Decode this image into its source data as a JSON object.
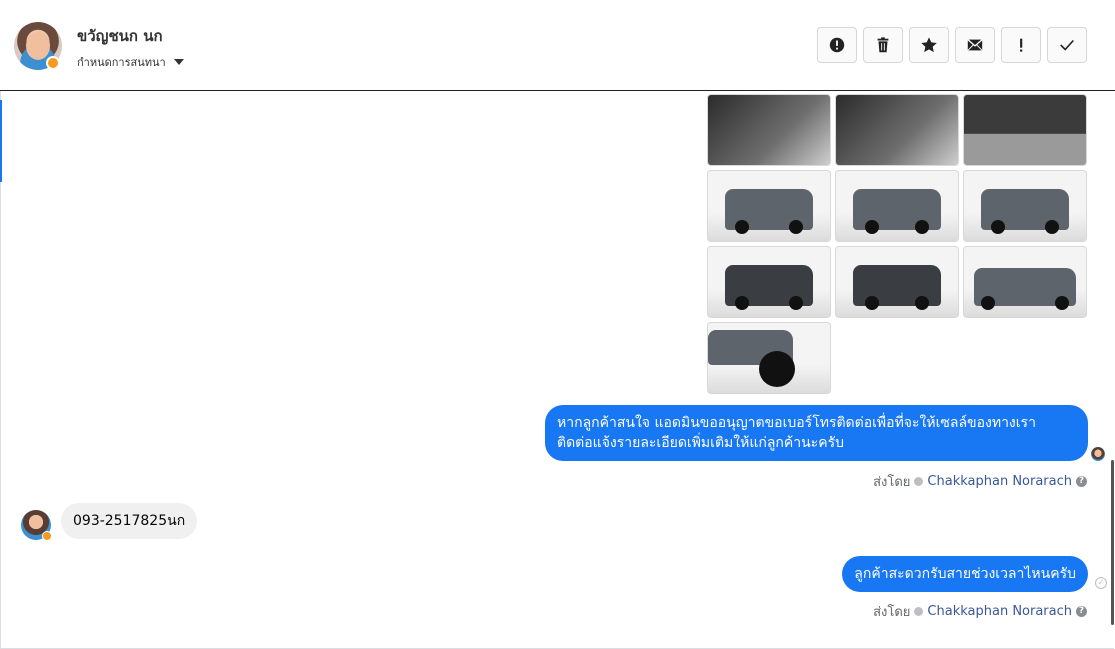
{
  "header": {
    "contact_name": "ขวัญชนก นก",
    "assign_label": "กำหนดการสนทนา",
    "actions": [
      {
        "icon": "alert-circle-icon",
        "name": "mark-spam-button"
      },
      {
        "icon": "trash-icon",
        "name": "delete-button"
      },
      {
        "icon": "star-icon",
        "name": "star-button"
      },
      {
        "icon": "envelope-icon",
        "name": "mark-unread-button"
      },
      {
        "icon": "exclamation-icon",
        "name": "follow-up-button"
      },
      {
        "icon": "check-icon",
        "name": "mark-done-button"
      }
    ],
    "status_color": "#f59a1d"
  },
  "images": [
    "interior-rear-seats",
    "interior-dashboard",
    "engine-bay",
    "front-left-view",
    "front-view",
    "front-right-view",
    "rear-left-view",
    "rear-view",
    "side-view",
    "front-wheel-closeup"
  ],
  "messages": [
    {
      "direction": "outgoing",
      "lines": [
        "หากลูกค้าสนใจ แอดมินขออนุญาตขอเบอร์โทรติดต่อเพื่อที่จะให้เซลล์ของทางเรา",
        "ติดต่อแจ้งรายละเอียดเพิ่มเติมให้แก่ลูกค้านะครับ"
      ],
      "sent_by_label": "ส่งโดย",
      "agent": "Chakkaphan Norarach"
    },
    {
      "direction": "incoming",
      "text": "093-2517825นก"
    },
    {
      "direction": "outgoing",
      "text": "ลูกค้าสะดวกรับสายช่วงเวลาไหนครับ",
      "sent_by_label": "ส่งโดย",
      "agent": "Chakkaphan Norarach"
    }
  ],
  "colors": {
    "accent": "#1877f2",
    "incoming_bubble": "#f0f0f0",
    "agent_link": "#385898"
  }
}
